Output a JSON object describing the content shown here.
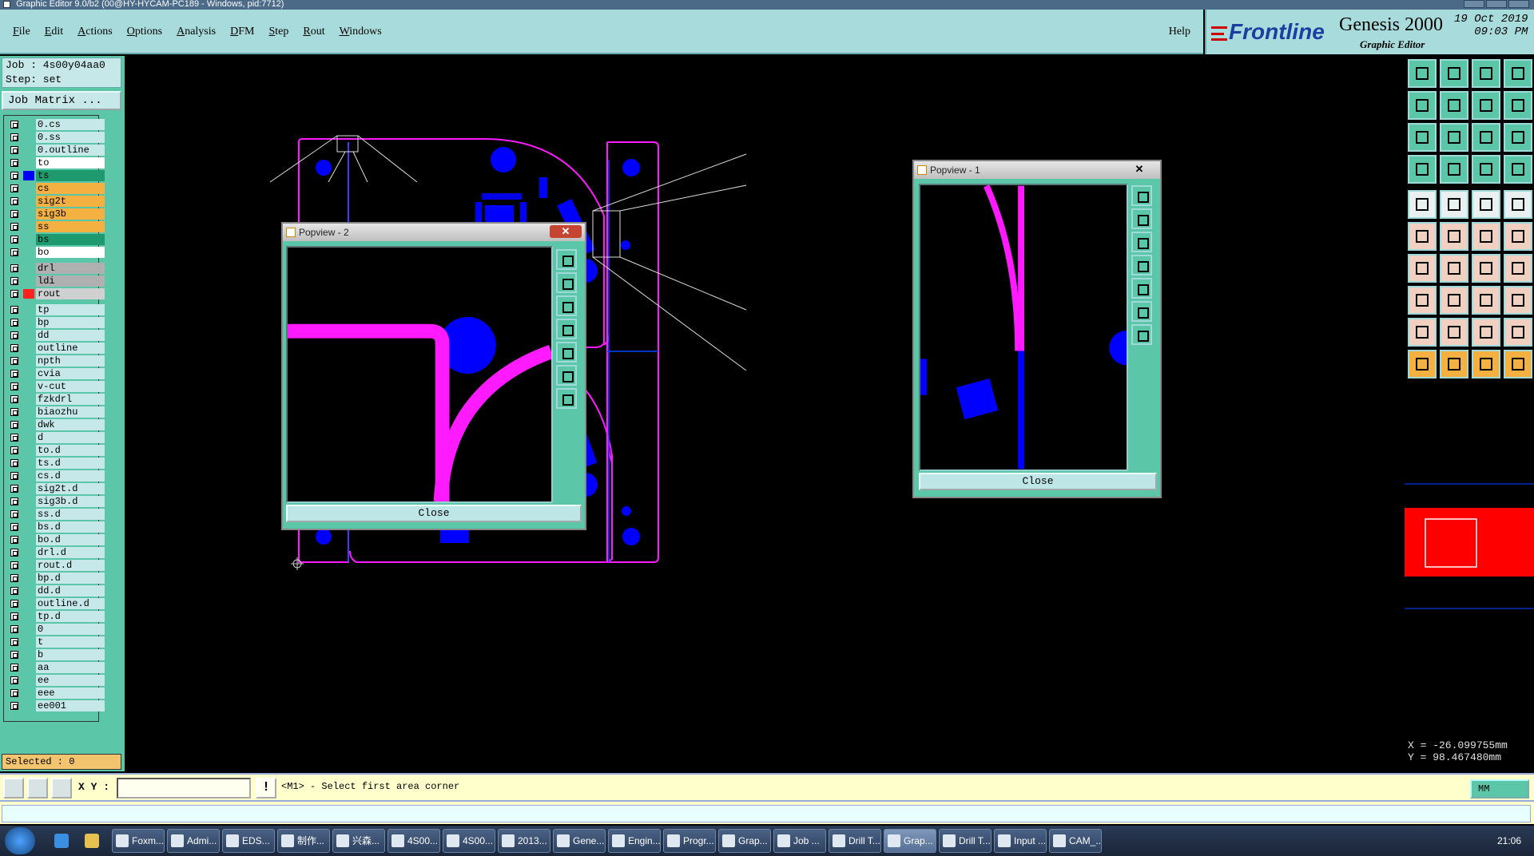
{
  "window": {
    "title": "Graphic Editor 9.0/b2 (00@HY-HYCAM-PC189 - Windows, pid:7712)"
  },
  "menu": {
    "items": [
      "File",
      "Edit",
      "Actions",
      "Options",
      "Analysis",
      "DFM",
      "Step",
      "Rout",
      "Windows"
    ],
    "help": "Help"
  },
  "brand": {
    "logo": "Frontline",
    "product": "Genesis 2000",
    "subtitle": "Graphic Editor",
    "date": "19 Oct 2019",
    "time": "09:03 PM"
  },
  "job": {
    "job_line": "Job : 4s00y04aa0",
    "step_line": "Step: set",
    "matrix_button": "Job Matrix ..."
  },
  "layers": [
    {
      "name": "0.cs",
      "color": "#c6e8e8"
    },
    {
      "name": "0.ss",
      "color": "#c6e8e8"
    },
    {
      "name": "0.outline",
      "color": "#c6e8e8"
    },
    {
      "name": "to",
      "color": "#ffffff"
    },
    {
      "name": "ts",
      "color": "#1f9a6e",
      "swatch": "#0000ff"
    },
    {
      "name": "cs",
      "color": "#f4b040"
    },
    {
      "name": "sig2t",
      "color": "#f4b040"
    },
    {
      "name": "sig3b",
      "color": "#f4b040"
    },
    {
      "name": "ss",
      "color": "#f4b040"
    },
    {
      "name": "bs",
      "color": "#1f9a6e"
    },
    {
      "name": "bo",
      "color": "#ffffff"
    },
    {
      "name": "drl",
      "color": "#b0b0b0"
    },
    {
      "name": "ldi",
      "color": "#b0b0b0"
    },
    {
      "name": "rout",
      "color": "#d0d0d0",
      "swatch": "#ff2020"
    },
    {
      "name": "tp",
      "color": "#c6e8e8"
    },
    {
      "name": "bp",
      "color": "#c6e8e8"
    },
    {
      "name": "dd",
      "color": "#c6e8e8"
    },
    {
      "name": "outline",
      "color": "#c6e8e8"
    },
    {
      "name": "npth",
      "color": "#c6e8e8"
    },
    {
      "name": "cvia",
      "color": "#c6e8e8"
    },
    {
      "name": "v-cut",
      "color": "#c6e8e8"
    },
    {
      "name": "fzkdrl",
      "color": "#c6e8e8"
    },
    {
      "name": "biaozhu",
      "color": "#c6e8e8"
    },
    {
      "name": "dwk",
      "color": "#c6e8e8"
    },
    {
      "name": "d",
      "color": "#c6e8e8"
    },
    {
      "name": "to.d",
      "color": "#c6e8e8"
    },
    {
      "name": "ts.d",
      "color": "#c6e8e8"
    },
    {
      "name": "cs.d",
      "color": "#c6e8e8"
    },
    {
      "name": "sig2t.d",
      "color": "#c6e8e8"
    },
    {
      "name": "sig3b.d",
      "color": "#c6e8e8"
    },
    {
      "name": "ss.d",
      "color": "#c6e8e8"
    },
    {
      "name": "bs.d",
      "color": "#c6e8e8"
    },
    {
      "name": "bo.d",
      "color": "#c6e8e8"
    },
    {
      "name": "drl.d",
      "color": "#c6e8e8"
    },
    {
      "name": "rout.d",
      "color": "#c6e8e8"
    },
    {
      "name": "bp.d",
      "color": "#c6e8e8"
    },
    {
      "name": "dd.d",
      "color": "#c6e8e8"
    },
    {
      "name": "outline.d",
      "color": "#c6e8e8"
    },
    {
      "name": "tp.d",
      "color": "#c6e8e8"
    },
    {
      "name": "0",
      "color": "#c6e8e8"
    },
    {
      "name": "t",
      "color": "#c6e8e8"
    },
    {
      "name": "b",
      "color": "#c6e8e8"
    },
    {
      "name": "aa",
      "color": "#c6e8e8"
    },
    {
      "name": "ee",
      "color": "#c6e8e8"
    },
    {
      "name": "eee",
      "color": "#c6e8e8"
    },
    {
      "name": "ee001",
      "color": "#c6e8e8"
    }
  ],
  "status": {
    "selected": "Selected : 0"
  },
  "popview1": {
    "title": "Popview - 1",
    "close_label": "Close"
  },
  "popview2": {
    "title": "Popview - 2",
    "close_label": "Close"
  },
  "coords": {
    "x": "X = -26.099755mm",
    "y": "Y = 98.467480mm"
  },
  "command": {
    "xy_label": "X Y :",
    "input_value": "",
    "excl": "!",
    "prompt": "<M1> - Select first area corner",
    "units": "MM"
  },
  "taskbar": {
    "tasks": [
      "Foxm...",
      "Admi...",
      "EDS...",
      "制作...",
      "兴森...",
      "4S00...",
      "4S00...",
      "2013...",
      "Gene...",
      "Engin...",
      "Progr...",
      "Grap...",
      "Job ...",
      "Drill T...",
      "Grap...",
      "Drill T...",
      "Input ...",
      "CAM_..."
    ],
    "clock": "21:06"
  },
  "colors": {
    "accent": "#5cc6a8",
    "menubar": "#a8dcdc",
    "feature": "#0000ff",
    "rout": "#ff1aff"
  }
}
